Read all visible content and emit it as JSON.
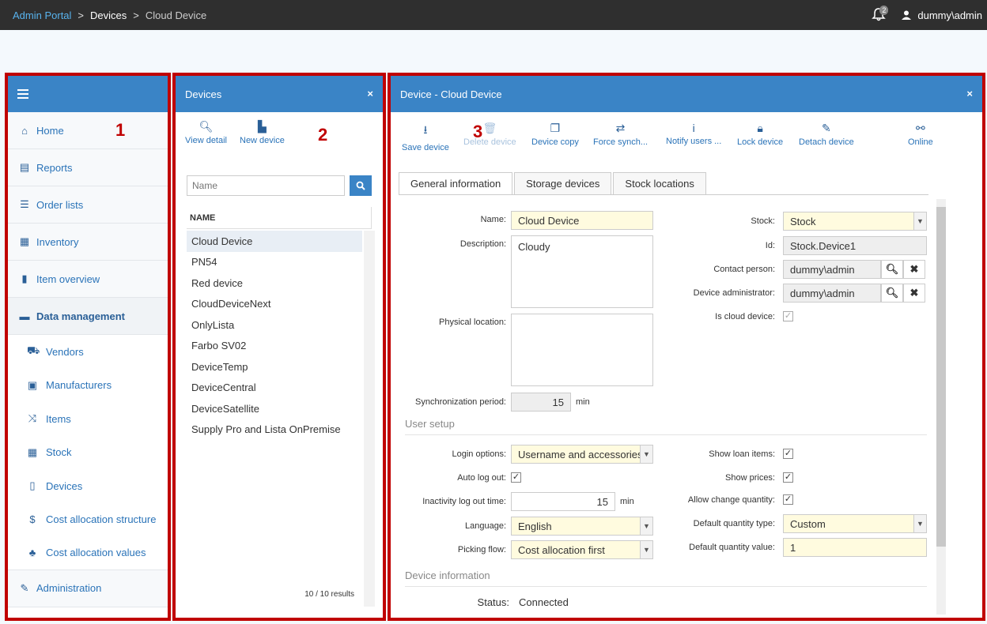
{
  "topbar": {
    "crumbs": [
      "Admin Portal",
      "Devices",
      "Cloud Device"
    ],
    "sep": ">",
    "notification_count": "2",
    "user": "dummy\\admin"
  },
  "annotations": [
    "1",
    "2",
    "3"
  ],
  "sidebar": {
    "items": [
      {
        "label": "Home",
        "icon": "home-icon"
      },
      {
        "label": "Reports",
        "icon": "printer-icon"
      },
      {
        "label": "Order lists",
        "icon": "list-icon"
      },
      {
        "label": "Inventory",
        "icon": "document-icon"
      },
      {
        "label": "Item overview",
        "icon": "bar-chart-icon"
      },
      {
        "label": "Data management",
        "icon": "briefcase-icon"
      }
    ],
    "sub_items": [
      {
        "label": "Vendors",
        "icon": "cart-icon"
      },
      {
        "label": "Manufacturers",
        "icon": "factory-icon"
      },
      {
        "label": "Items",
        "icon": "shuffle-icon"
      },
      {
        "label": "Stock",
        "icon": "grid-icon"
      },
      {
        "label": "Devices",
        "icon": "tablet-icon"
      },
      {
        "label": "Cost allocation structure",
        "icon": "dollar-icon"
      },
      {
        "label": "Cost allocation values",
        "icon": "tree-icon"
      }
    ],
    "admin": {
      "label": "Administration",
      "icon": "wrench-icon"
    }
  },
  "devices_panel": {
    "title": "Devices",
    "close": "×",
    "view_detail": "View detail",
    "new_device": "New device",
    "search_placeholder": "Name",
    "column_name": "NAME",
    "rows": [
      "Cloud Device",
      "PN54",
      "Red device",
      "CloudDeviceNext",
      "OnlyLista",
      "Farbo SV02",
      "DeviceTemp",
      "DeviceCentral",
      "DeviceSatellite",
      "Supply Pro and Lista OnPremise"
    ],
    "results": "10 / 10 results"
  },
  "detail_panel": {
    "title": "Device - Cloud Device",
    "close": "×",
    "toolbar": {
      "save": "Save device",
      "delete": "Delete device",
      "copy": "Device copy",
      "force_sync": "Force synch...",
      "notify": "Notify users ...",
      "lock": "Lock device",
      "detach": "Detach device",
      "online": "Online"
    },
    "tabs": [
      "General information",
      "Storage devices",
      "Stock locations"
    ],
    "general": {
      "name_label": "Name:",
      "name_value": "Cloud Device",
      "description_label": "Description:",
      "description_value": "Cloudy",
      "physical_location_label": "Physical location:",
      "sync_label": "Synchronization period:",
      "sync_value": "15",
      "sync_unit": "min",
      "stock_label": "Stock:",
      "stock_value": "Stock",
      "id_label": "Id:",
      "id_value": "Stock.Device1",
      "contact_label": "Contact person:",
      "contact_value": "dummy\\admin",
      "admin_label": "Device administrator:",
      "admin_value": "dummy\\admin",
      "cloud_label": "Is cloud device:"
    },
    "user_setup": {
      "title": "User setup",
      "login_label": "Login options:",
      "login_value": "Username and accessories",
      "autologout_label": "Auto log out:",
      "inactivity_label": "Inactivity log out time:",
      "inactivity_value": "15",
      "inactivity_unit": "min",
      "language_label": "Language:",
      "language_value": "English",
      "picking_label": "Picking flow:",
      "picking_value": "Cost allocation first",
      "loan_label": "Show loan items:",
      "prices_label": "Show prices:",
      "change_qty_label": "Allow change quantity:",
      "default_type_label": "Default quantity type:",
      "default_type_value": "Custom",
      "default_value_label": "Default quantity value:",
      "default_value_value": "1"
    },
    "device_info": {
      "title": "Device information",
      "status_label": "Status:",
      "status_value": "Connected"
    }
  }
}
